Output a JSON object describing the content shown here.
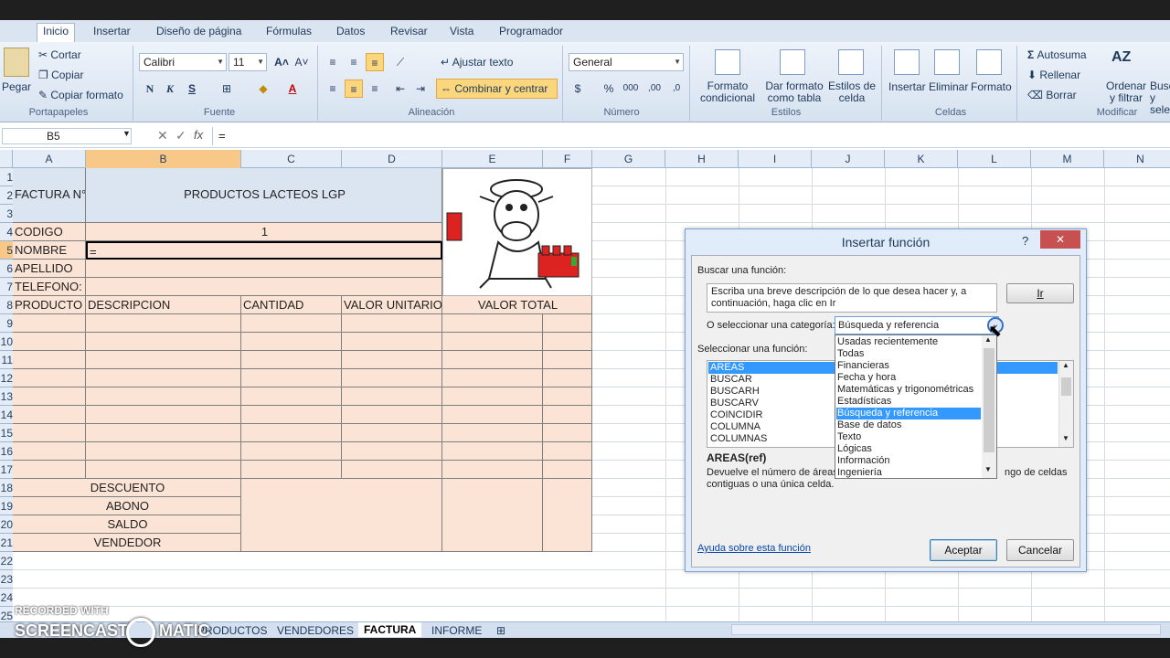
{
  "ribbon": {
    "tabs": [
      "Inicio",
      "Insertar",
      "Diseño de página",
      "Fórmulas",
      "Datos",
      "Revisar",
      "Vista",
      "Programador"
    ],
    "clipboard": {
      "paste": "Pegar",
      "cut": "Cortar",
      "copy": "Copiar",
      "format_painter": "Copiar formato",
      "label": "Portapapeles"
    },
    "font": {
      "name": "Calibri",
      "size": "11",
      "label": "Fuente",
      "bold": "N",
      "italic": "K",
      "underline": "S"
    },
    "alignment": {
      "wrap": "Ajustar texto",
      "merge": "Combinar y centrar",
      "label": "Alineación"
    },
    "number": {
      "format": "General",
      "label": "Número",
      "currency": "$",
      "percent": "%",
      "thousands": "000"
    },
    "styles": {
      "conditional": "Formato condicional",
      "table": "Dar formato como tabla",
      "cell_styles": "Estilos de celda",
      "label": "Estilos"
    },
    "cells": {
      "insert": "Insertar",
      "delete": "Eliminar",
      "format": "Formato",
      "label": "Celdas"
    },
    "editing": {
      "autosum": "Autosuma",
      "fill": "Rellenar",
      "clear": "Borrar",
      "sort": "Ordenar y filtrar",
      "select": "Buscar y sele",
      "label": "Modificar"
    }
  },
  "formula_bar": {
    "name_box": "B5",
    "formula": "="
  },
  "columns": [
    "A",
    "B",
    "C",
    "D",
    "E",
    "F",
    "G",
    "H",
    "I",
    "J",
    "K",
    "L",
    "M",
    "N"
  ],
  "rows": [
    "1",
    "2",
    "3",
    "4",
    "5",
    "6",
    "7",
    "8",
    "9",
    "10",
    "11",
    "12",
    "13",
    "14",
    "15",
    "16",
    "17",
    "18",
    "19",
    "20",
    "21",
    "22",
    "23",
    "24",
    "25"
  ],
  "sheet": {
    "factura_label": "FACTURA N°",
    "title": "PRODUCTOS LACTEOS LGP",
    "codigo_label": "CODIGO",
    "codigo_value": "1",
    "nombre_label": "NOMBRE",
    "nombre_value": "=",
    "apellido_label": "APELLIDO",
    "telefono_label": "TELEFONO:",
    "headers": [
      "PRODUCTO",
      "DESCRIPCION",
      "CANTIDAD",
      "VALOR UNITARIO",
      "VALOR TOTAL"
    ],
    "footer": [
      "DESCUENTO",
      "ABONO",
      "SALDO",
      "VENDEDOR"
    ]
  },
  "dialog": {
    "title": "Insertar función",
    "help_btn": "?",
    "close_btn": "✕",
    "search_label": "Buscar una función:",
    "search_text": "Escriba una breve descripción de lo que desea hacer y, a continuación, haga clic en Ir",
    "go_button": "Ir",
    "category_label": "O seleccionar una categoría:",
    "category_value": "Búsqueda y referencia",
    "category_options": [
      "Usadas recientemente",
      "Todas",
      "Financieras",
      "Fecha y hora",
      "Matemáticas y trigonométricas",
      "Estadísticas",
      "Búsqueda y referencia",
      "Base de datos",
      "Texto",
      "Lógicas",
      "Información",
      "Ingeniería"
    ],
    "function_label": "Seleccionar una función:",
    "functions": [
      "AREAS",
      "BUSCAR",
      "BUSCARH",
      "BUSCARV",
      "COINCIDIR",
      "COLUMNA",
      "COLUMNAS"
    ],
    "signature": "AREAS(ref)",
    "description_start": "Devuelve el número de áreas",
    "description_end": "ngo de celdas",
    "description_line2": "contiguas o una única celda.",
    "help_link": "Ayuda sobre esta función",
    "ok": "Aceptar",
    "cancel": "Cancelar"
  },
  "sheet_tabs": [
    "PRODUCTOS",
    "VENDEDORES",
    "FACTURA",
    "INFORME"
  ],
  "active_sheet": "FACTURA",
  "watermark": {
    "line1": "RECORDED WITH",
    "line2": "SCREENCAST",
    "line3": "MATIC"
  }
}
